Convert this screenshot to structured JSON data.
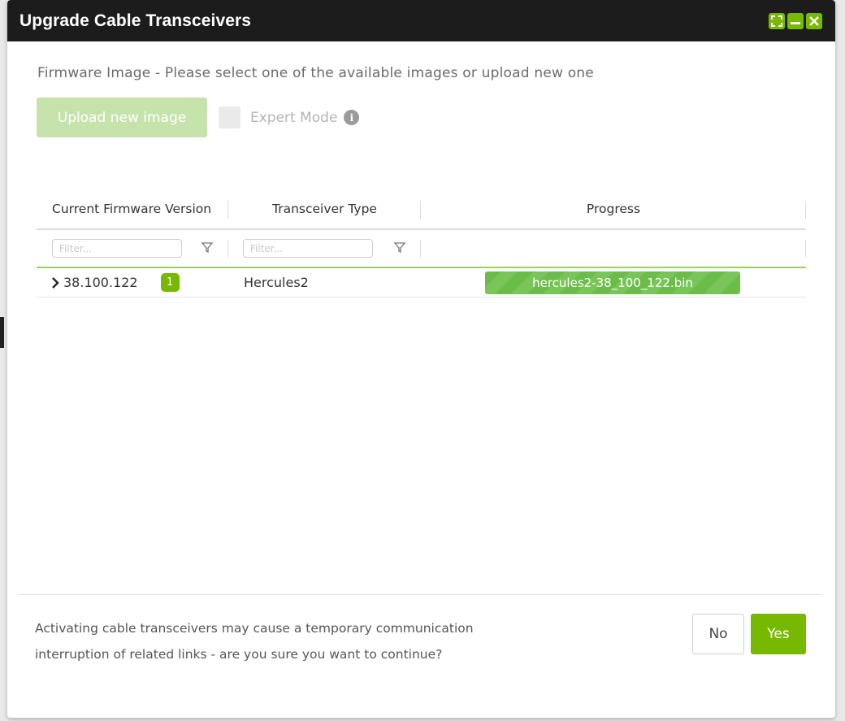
{
  "dialog": {
    "title": "Upgrade Cable Transceivers",
    "window_controls": [
      "maximize-icon",
      "minimize-icon",
      "close-icon"
    ]
  },
  "firmware": {
    "subtitle": "Firmware Image - Please select one of the available images or upload new one",
    "upload_label": "Upload new image",
    "expert_mode_label": "Expert Mode",
    "expert_mode_checked": false
  },
  "table": {
    "columns": [
      "Current Firmware Version",
      "Transceiver Type",
      "Progress"
    ],
    "filter_placeholder": "Filter...",
    "rows": [
      {
        "version": "38.100.122",
        "count": "1",
        "type": "Hercules2",
        "progress_label": "hercules2-38_100_122.bin",
        "progress": 1.0
      }
    ]
  },
  "footer": {
    "message_line1": "Activating cable transceivers may cause a temporary communication",
    "message_line2": "interruption of related links - are you sure you want to continue?",
    "no_label": "No",
    "yes_label": "Yes"
  },
  "colors": {
    "accent": "#76b900",
    "titlebar": "#1c1c1c",
    "progress": "#6cbc4a",
    "upload_disabled": "#c6e3ac"
  }
}
